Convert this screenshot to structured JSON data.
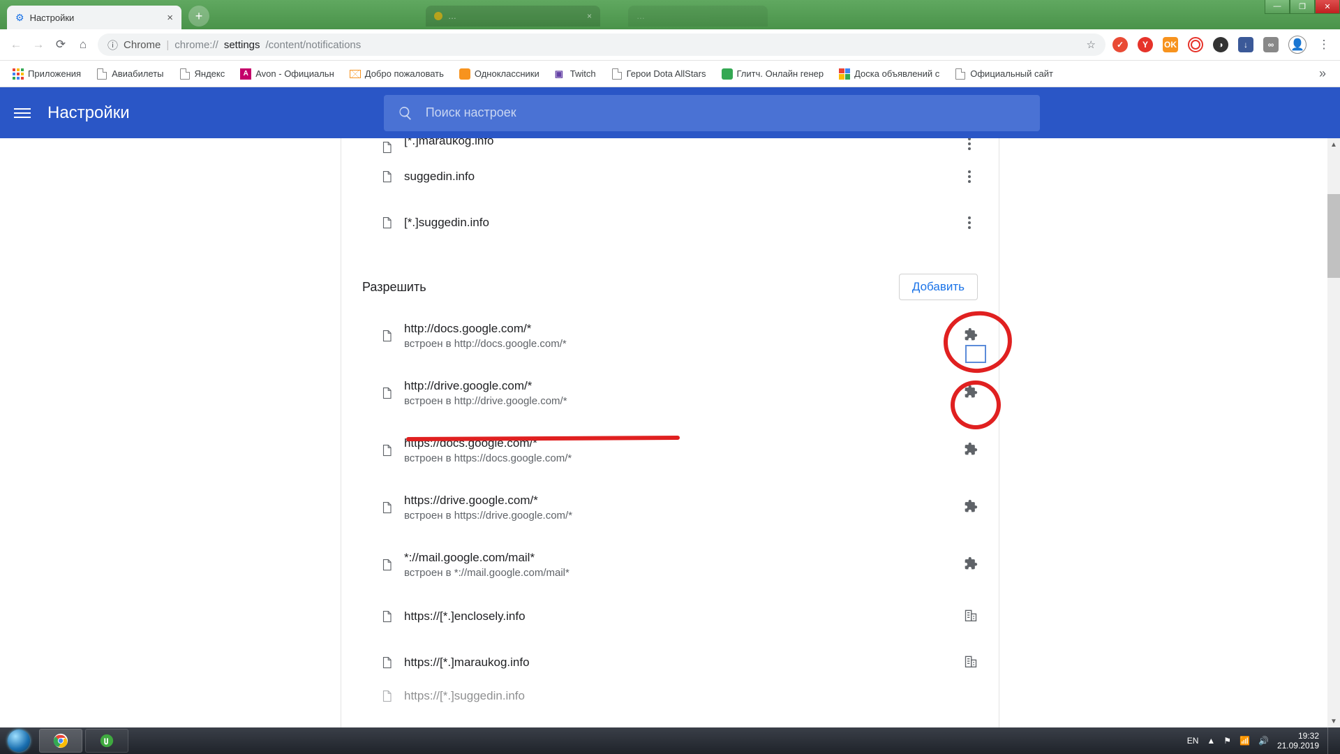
{
  "window": {
    "tab_title": "Настройки"
  },
  "addr": {
    "secure": "Chrome",
    "scheme_grey1": "chrome://",
    "black": "settings",
    "grey2": "/content/notifications"
  },
  "bookmarks": [
    {
      "label": "Приложения",
      "icon": "apps"
    },
    {
      "label": "Авиабилеты",
      "icon": "file"
    },
    {
      "label": "Яндекс",
      "icon": "file"
    },
    {
      "label": "Avon - Официальн",
      "icon": "avon"
    },
    {
      "label": "Добро пожаловать",
      "icon": "mail"
    },
    {
      "label": "Одноклассники",
      "icon": "ok"
    },
    {
      "label": "Twitch",
      "icon": "twitch"
    },
    {
      "label": "Герои Dota AllStars",
      "icon": "file"
    },
    {
      "label": "Глитч. Онлайн генер",
      "icon": "glitch"
    },
    {
      "label": "Доска объявлений с",
      "icon": "board"
    },
    {
      "label": "Официальный сайт",
      "icon": "file"
    }
  ],
  "settings": {
    "title": "Настройки",
    "search_placeholder": "Поиск настроек",
    "top_partial": "[*.]maraukog.info",
    "blocked": [
      {
        "site": "suggedin.info"
      },
      {
        "site": "[*.]suggedin.info"
      }
    ],
    "allow_heading": "Разрешить",
    "add_button": "Добавить",
    "allowed": [
      {
        "site": "http://docs.google.com/*",
        "sub": "встроен в http://docs.google.com/*",
        "kind": "puzzle"
      },
      {
        "site": "http://drive.google.com/*",
        "sub": "встроен в http://drive.google.com/*",
        "kind": "puzzle"
      },
      {
        "site": "https://docs.google.com/*",
        "sub": "встроен в https://docs.google.com/*",
        "kind": "puzzle"
      },
      {
        "site": "https://drive.google.com/*",
        "sub": "встроен в https://drive.google.com/*",
        "kind": "puzzle"
      },
      {
        "site": "*://mail.google.com/mail*",
        "sub": "встроен в *://mail.google.com/mail*",
        "kind": "puzzle"
      },
      {
        "site": "https://[*.]enclosely.info",
        "sub": "",
        "kind": "building"
      },
      {
        "site": "https://[*.]maraukog.info",
        "sub": "",
        "kind": "building"
      }
    ],
    "bottom_partial": "https://[*.]suggedin.info"
  },
  "tray": {
    "lang": "EN",
    "time": "19:32",
    "date": "21.09.2019"
  }
}
